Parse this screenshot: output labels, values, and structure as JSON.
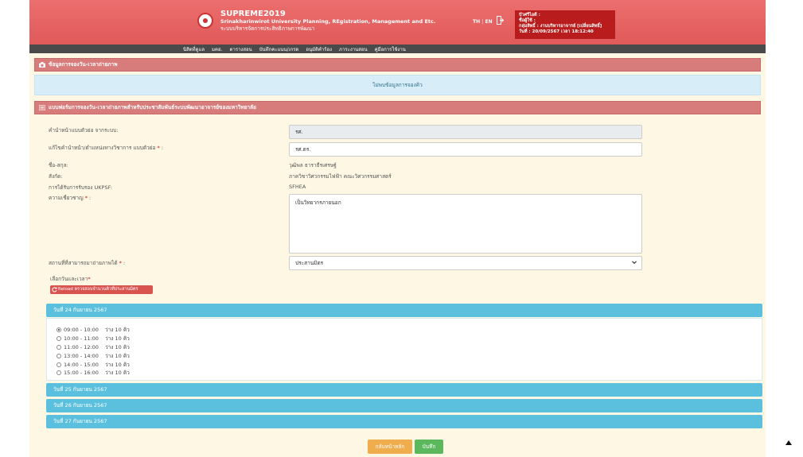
{
  "header": {
    "brand_title": "SUPREME2019",
    "brand_subtitle": "Srinakharinwirot University Planning, REgistration, Management and Etc.",
    "brand_thai": "ระบบบริหารจัดการประสิทธิภาพการพัฒนา",
    "lang_th": "TH",
    "lang_sep": "|",
    "lang_en": "EN",
    "user_line1": "บัวศรีไอดี :",
    "user_line2": "ชื่อผู้ใช้ :",
    "user_line3": "กลุ่มสิทธิ์ : งานบริหารอาจารย์ [เปลี่ยนสิทธิ์]",
    "user_line4": "วันที่ : 20/09/2567 เวลา 18:12:40"
  },
  "nav": {
    "items": [
      "นิสิตที่ดูแล",
      "มคอ.",
      "ตารางสอน",
      "บันทึกคะแนน/เกรด",
      "อนุมัติคำร้อง",
      "ภาระงานสอน",
      "คู่มือการใช้งาน"
    ]
  },
  "booking_panel": {
    "title": "ข้อมูลการจองวัน-เวลาถ่ายภาพ",
    "no_data": "ไม่พบข้อมูลการจองคิว"
  },
  "form_panel": {
    "title": "แบบฟอร์มการจองวัน-เวลาถ่ายภาพสำหรับประชาสัมพันธ์ระบบพัฒนาอาจารย์ของมหาวิทยาลัย",
    "fields": {
      "prefix_label": "คำนำหน้าแบบตัวย่อ จากระบบ:",
      "prefix_value": "รศ.",
      "prefix_edit_label": "แก้ไขคำนำหน้า/ตำแหน่งทางวิชาการ แบบตัวย่อ",
      "prefix_edit_value": "รศ.ดร.",
      "name_label": "ชื่อ-สกุล:",
      "name_value": "วุฒิพล ธาราธีรเศรษฐ์",
      "affiliation_label": "สังกัด:",
      "affiliation_value": "ภาควิชาวิศวกรรมไฟฟ้า คณะวิศวกรรมศาสตร์",
      "ukpsf_label": "การได้รับการรับรอง UKPSF:",
      "ukpsf_value": "SFHEA",
      "expertise_label": "ความเชี่ยวชาญ",
      "expertise_value": "เป็นวิทยากรภายนอก",
      "location_label": "สถานที่ที่สามารถมาถ่ายภาพได้",
      "location_value": "ประสานมิตร",
      "required_mark": "*",
      "colon": " :"
    },
    "datetime_label": "เลือกวันและเวลา",
    "reload_label": "Reload ตรวจสอบจำนวนคิวที่ประสานมิตร",
    "days": [
      {
        "label": "วันที่ 24 กันยายน 2567"
      },
      {
        "label": "วันที่ 25 กันยายน 2567"
      },
      {
        "label": "วันที่ 26 กันยายน 2567"
      },
      {
        "label": "วันที่ 27 กันยายน 2567"
      }
    ],
    "slots": [
      {
        "time": "09:00 - 10:00",
        "avail": "ว่าง 10 คิว",
        "selected": true
      },
      {
        "time": "10:00 - 11:00",
        "avail": "ว่าง 10 คิว",
        "selected": false
      },
      {
        "time": "11:00 - 12:00",
        "avail": "ว่าง 10 คิว",
        "selected": false
      },
      {
        "time": "13:00 - 14:00",
        "avail": "ว่าง 10 คิว",
        "selected": false
      },
      {
        "time": "14:00 - 15:00",
        "avail": "ว่าง 10 คิว",
        "selected": false
      },
      {
        "time": "15:00 - 16:00",
        "avail": "ว่าง 10 คิว",
        "selected": false
      }
    ],
    "back_label": "กลับหน้าหลัก",
    "save_label": "บันทึก"
  },
  "colors": {
    "header": "#e05a5a",
    "nav": "#4a4a4a",
    "panel_head": "#d87b7b",
    "info": "#d7edf7",
    "day_bar": "#5bc0de",
    "reload": "#d9534f",
    "back": "#f0ad4e",
    "save": "#5cb85c"
  },
  "icons": {
    "logo": "university-seal-icon",
    "exit": "exit-icon",
    "camera": "camera-icon",
    "list": "list-icon",
    "reload": "refresh-icon",
    "chevron": "chevron-down-icon",
    "scroll_top": "arrow-up-icon"
  }
}
